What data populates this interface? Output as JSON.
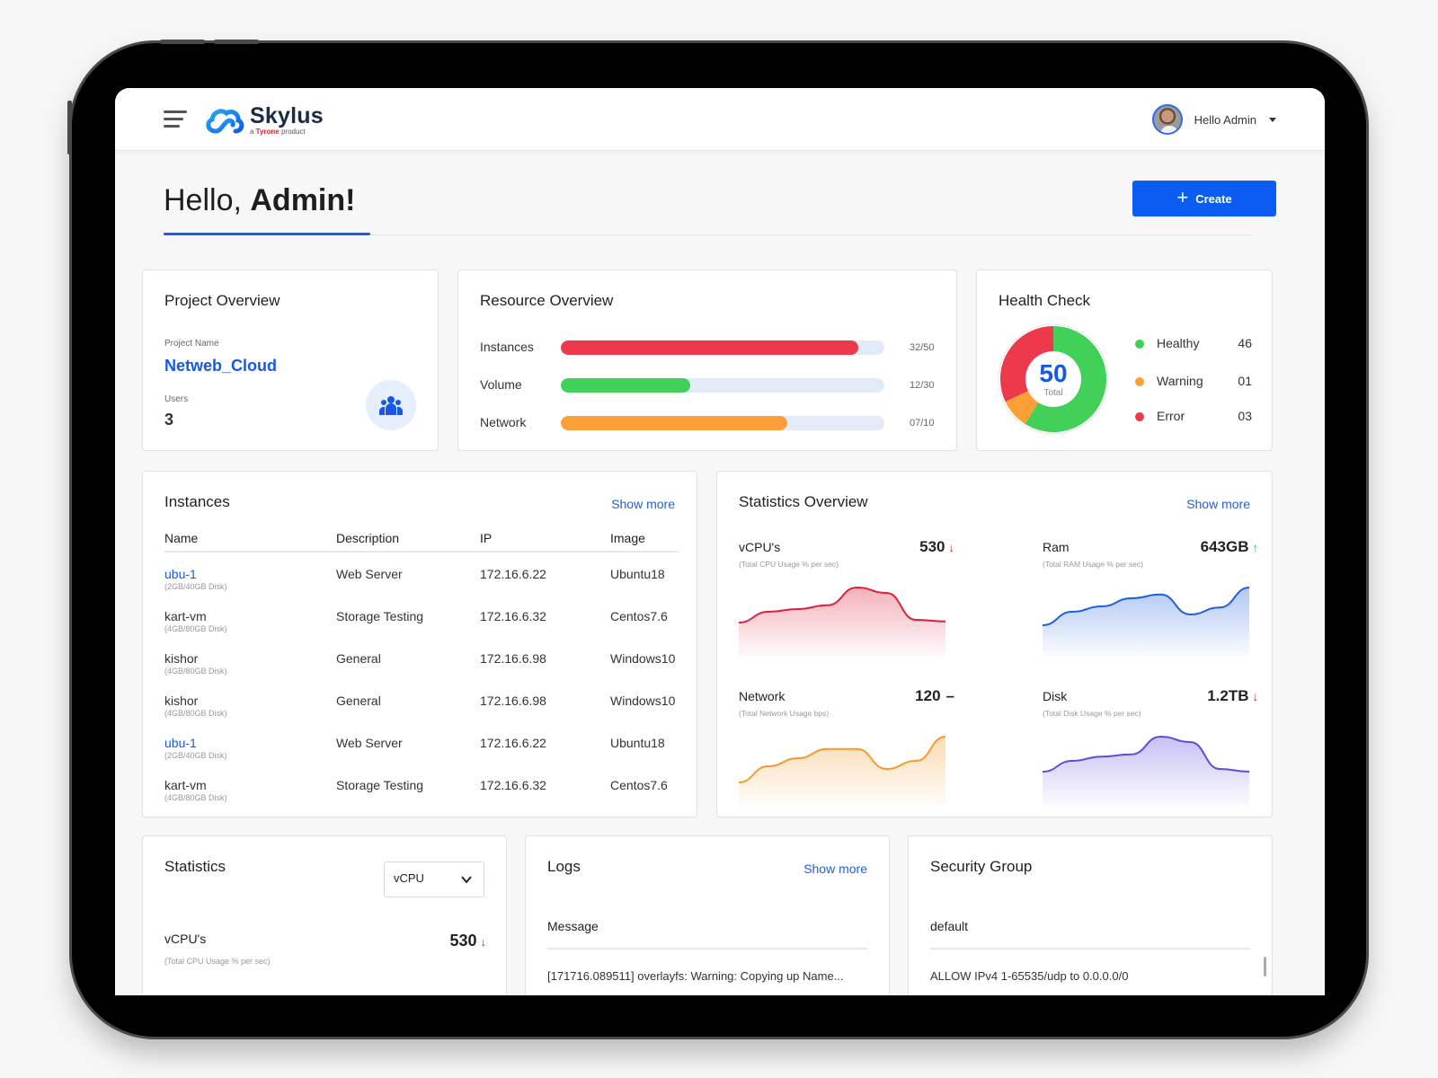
{
  "header": {
    "brand": "Skylus",
    "tagline_prefix": "a ",
    "tagline_brand": "Tyrone",
    "tagline_suffix": " product",
    "user_greeting": "Hello Admin"
  },
  "greeting": {
    "prefix": "Hello, ",
    "name": "Admin!"
  },
  "create_button": {
    "label": "Create",
    "icon": "plus-icon"
  },
  "project_overview": {
    "title": "Project Overview",
    "name_label": "Project Name",
    "name": "Netweb_Cloud",
    "users_label": "Users",
    "users": "3",
    "icon": "users-group-icon"
  },
  "resource_overview": {
    "title": "Resource Overview",
    "items": [
      {
        "label": "Instances",
        "used": 32,
        "total": 50,
        "value": "32/50",
        "color": "#ec3a4c"
      },
      {
        "label": "Volume",
        "used": 12,
        "total": 30,
        "value": "12/30",
        "color": "#42d158"
      },
      {
        "label": "Network",
        "used": 7,
        "total": 10,
        "value": "07/10",
        "color": "#fc9f36"
      }
    ]
  },
  "health_check": {
    "title": "Health Check",
    "total": "50",
    "total_label": "Total",
    "items": [
      {
        "label": "Healthy",
        "count": "46",
        "share": 0.59,
        "color": "#42d158"
      },
      {
        "label": "Warning",
        "count": "01",
        "share": 0.09,
        "color": "#fc9f36"
      },
      {
        "label": "Error",
        "count": "03",
        "share": 0.32,
        "color": "#ec3a4c"
      }
    ]
  },
  "instances": {
    "title": "Instances",
    "show_more": "Show more",
    "columns": [
      "Name",
      "Description",
      "IP",
      "Image"
    ],
    "rows": [
      {
        "name": "ubu-1",
        "spec": "(2GB/40GB Disk)",
        "link": true,
        "description": "Web Server",
        "ip": "172.16.6.22",
        "image": "Ubuntu18"
      },
      {
        "name": "kart-vm",
        "spec": "(4GB/80GB Disk)",
        "link": false,
        "description": "Storage Testing",
        "ip": "172.16.6.32",
        "image": "Centos7.6"
      },
      {
        "name": "kishor",
        "spec": "(4GB/80GB Disk)",
        "link": false,
        "description": "General",
        "ip": "172.16.6.98",
        "image": "Windows10"
      },
      {
        "name": "kishor",
        "spec": "(4GB/80GB Disk)",
        "link": false,
        "description": "General",
        "ip": "172.16.6.98",
        "image": "Windows10"
      },
      {
        "name": "ubu-1",
        "spec": "(2GB/40GB Disk)",
        "link": true,
        "description": "Web Server",
        "ip": "172.16.6.22",
        "image": "Ubuntu18"
      },
      {
        "name": "kart-vm",
        "spec": "(4GB/80GB Disk)",
        "link": false,
        "description": "Storage Testing",
        "ip": "172.16.6.32",
        "image": "Centos7.6"
      }
    ]
  },
  "statistics_overview": {
    "title": "Statistics Overview",
    "show_more": "Show more",
    "stats": [
      {
        "name": "vCPU's",
        "sub": "(Total CPU Usage % per sec)",
        "value": "530",
        "trend": "down",
        "trend_glyph": "↓",
        "color": "#e0203a",
        "series": [
          0.3,
          0.5,
          0.55,
          0.62,
          0.95,
          0.85,
          0.35,
          0.32
        ]
      },
      {
        "name": "Ram",
        "sub": "(Total RAM Usage % per sec)",
        "value": "643GB",
        "trend": "up",
        "trend_glyph": "↑",
        "color": "#1e5fe0",
        "series": [
          0.25,
          0.5,
          0.6,
          0.75,
          0.82,
          0.45,
          0.58,
          0.95
        ]
      },
      {
        "name": "Network",
        "sub": "(Total Network Usage bps)",
        "value": "120",
        "trend": "flat",
        "trend_glyph": "–",
        "color": "#f59a2a",
        "series": [
          0.1,
          0.4,
          0.55,
          0.72,
          0.72,
          0.35,
          0.5,
          0.95
        ]
      },
      {
        "name": "Disk",
        "sub": "(Total Disk Usage % per sec)",
        "value": "1.2TB",
        "trend": "down",
        "trend_glyph": "↓",
        "color": "#5a4de0",
        "series": [
          0.3,
          0.5,
          0.58,
          0.62,
          0.95,
          0.85,
          0.35,
          0.3
        ]
      }
    ]
  },
  "statistics": {
    "title": "Statistics",
    "select_value": "vCPU",
    "metric_name": "vCPU's",
    "metric_sub": "(Total CPU Usage % per sec)",
    "metric_value": "530",
    "trend_glyph": "↓"
  },
  "logs": {
    "title": "Logs",
    "show_more": "Show more",
    "column": "Message",
    "first_entry": "[171716.089511] overlayfs: Warning: Copying up Name..."
  },
  "security_group": {
    "title": "Security Group",
    "name": "default",
    "first_rule": "ALLOW IPv4 1-65535/udp to 0.0.0.0/0"
  }
}
